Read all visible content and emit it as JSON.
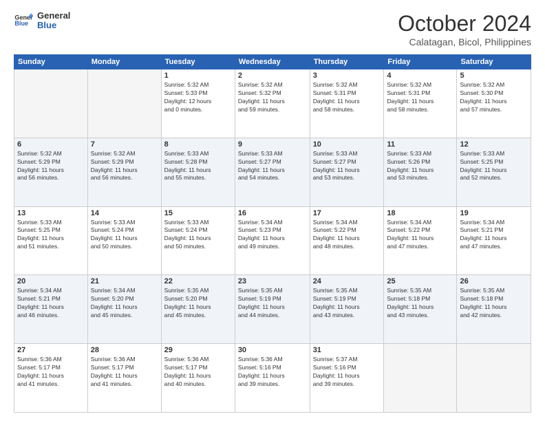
{
  "header": {
    "logo_line1": "General",
    "logo_line2": "Blue",
    "month": "October 2024",
    "location": "Calatagan, Bicol, Philippines"
  },
  "weekdays": [
    "Sunday",
    "Monday",
    "Tuesday",
    "Wednesday",
    "Thursday",
    "Friday",
    "Saturday"
  ],
  "weeks": [
    [
      {
        "day": "",
        "info": ""
      },
      {
        "day": "",
        "info": ""
      },
      {
        "day": "1",
        "info": "Sunrise: 5:32 AM\nSunset: 5:33 PM\nDaylight: 12 hours\nand 0 minutes."
      },
      {
        "day": "2",
        "info": "Sunrise: 5:32 AM\nSunset: 5:32 PM\nDaylight: 11 hours\nand 59 minutes."
      },
      {
        "day": "3",
        "info": "Sunrise: 5:32 AM\nSunset: 5:31 PM\nDaylight: 11 hours\nand 58 minutes."
      },
      {
        "day": "4",
        "info": "Sunrise: 5:32 AM\nSunset: 5:31 PM\nDaylight: 11 hours\nand 58 minutes."
      },
      {
        "day": "5",
        "info": "Sunrise: 5:32 AM\nSunset: 5:30 PM\nDaylight: 11 hours\nand 57 minutes."
      }
    ],
    [
      {
        "day": "6",
        "info": "Sunrise: 5:32 AM\nSunset: 5:29 PM\nDaylight: 11 hours\nand 56 minutes."
      },
      {
        "day": "7",
        "info": "Sunrise: 5:32 AM\nSunset: 5:29 PM\nDaylight: 11 hours\nand 56 minutes."
      },
      {
        "day": "8",
        "info": "Sunrise: 5:33 AM\nSunset: 5:28 PM\nDaylight: 11 hours\nand 55 minutes."
      },
      {
        "day": "9",
        "info": "Sunrise: 5:33 AM\nSunset: 5:27 PM\nDaylight: 11 hours\nand 54 minutes."
      },
      {
        "day": "10",
        "info": "Sunrise: 5:33 AM\nSunset: 5:27 PM\nDaylight: 11 hours\nand 53 minutes."
      },
      {
        "day": "11",
        "info": "Sunrise: 5:33 AM\nSunset: 5:26 PM\nDaylight: 11 hours\nand 53 minutes."
      },
      {
        "day": "12",
        "info": "Sunrise: 5:33 AM\nSunset: 5:25 PM\nDaylight: 11 hours\nand 52 minutes."
      }
    ],
    [
      {
        "day": "13",
        "info": "Sunrise: 5:33 AM\nSunset: 5:25 PM\nDaylight: 11 hours\nand 51 minutes."
      },
      {
        "day": "14",
        "info": "Sunrise: 5:33 AM\nSunset: 5:24 PM\nDaylight: 11 hours\nand 50 minutes."
      },
      {
        "day": "15",
        "info": "Sunrise: 5:33 AM\nSunset: 5:24 PM\nDaylight: 11 hours\nand 50 minutes."
      },
      {
        "day": "16",
        "info": "Sunrise: 5:34 AM\nSunset: 5:23 PM\nDaylight: 11 hours\nand 49 minutes."
      },
      {
        "day": "17",
        "info": "Sunrise: 5:34 AM\nSunset: 5:22 PM\nDaylight: 11 hours\nand 48 minutes."
      },
      {
        "day": "18",
        "info": "Sunrise: 5:34 AM\nSunset: 5:22 PM\nDaylight: 11 hours\nand 47 minutes."
      },
      {
        "day": "19",
        "info": "Sunrise: 5:34 AM\nSunset: 5:21 PM\nDaylight: 11 hours\nand 47 minutes."
      }
    ],
    [
      {
        "day": "20",
        "info": "Sunrise: 5:34 AM\nSunset: 5:21 PM\nDaylight: 11 hours\nand 46 minutes."
      },
      {
        "day": "21",
        "info": "Sunrise: 5:34 AM\nSunset: 5:20 PM\nDaylight: 11 hours\nand 45 minutes."
      },
      {
        "day": "22",
        "info": "Sunrise: 5:35 AM\nSunset: 5:20 PM\nDaylight: 11 hours\nand 45 minutes."
      },
      {
        "day": "23",
        "info": "Sunrise: 5:35 AM\nSunset: 5:19 PM\nDaylight: 11 hours\nand 44 minutes."
      },
      {
        "day": "24",
        "info": "Sunrise: 5:35 AM\nSunset: 5:19 PM\nDaylight: 11 hours\nand 43 minutes."
      },
      {
        "day": "25",
        "info": "Sunrise: 5:35 AM\nSunset: 5:18 PM\nDaylight: 11 hours\nand 43 minutes."
      },
      {
        "day": "26",
        "info": "Sunrise: 5:35 AM\nSunset: 5:18 PM\nDaylight: 11 hours\nand 42 minutes."
      }
    ],
    [
      {
        "day": "27",
        "info": "Sunrise: 5:36 AM\nSunset: 5:17 PM\nDaylight: 11 hours\nand 41 minutes."
      },
      {
        "day": "28",
        "info": "Sunrise: 5:36 AM\nSunset: 5:17 PM\nDaylight: 11 hours\nand 41 minutes."
      },
      {
        "day": "29",
        "info": "Sunrise: 5:36 AM\nSunset: 5:17 PM\nDaylight: 11 hours\nand 40 minutes."
      },
      {
        "day": "30",
        "info": "Sunrise: 5:36 AM\nSunset: 5:16 PM\nDaylight: 11 hours\nand 39 minutes."
      },
      {
        "day": "31",
        "info": "Sunrise: 5:37 AM\nSunset: 5:16 PM\nDaylight: 11 hours\nand 39 minutes."
      },
      {
        "day": "",
        "info": ""
      },
      {
        "day": "",
        "info": ""
      }
    ]
  ]
}
